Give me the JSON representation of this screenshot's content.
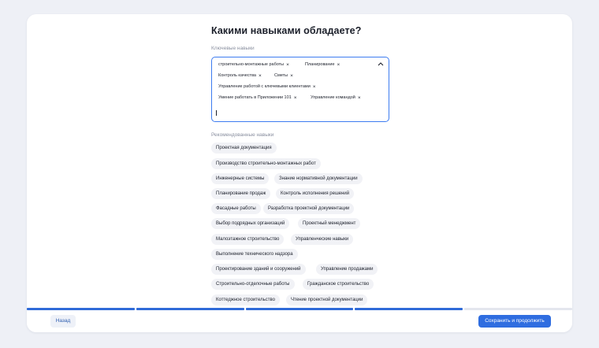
{
  "page": {
    "title": "Какими навыками обладаете?",
    "key_skills_label": "Ключевые навыки",
    "recommended_label": "Рекомендованные навыки"
  },
  "selected_skills": [
    "строительно-монтажные работы",
    "Планирование",
    "Контроль качества",
    "Сметы",
    "Управление работой с ключевыми клиентами",
    "Умение работать в Приложении 101",
    "Управление командой"
  ],
  "remove_glyph": "×",
  "recommended_skills": [
    "Проектная документация",
    "Производство строительно-монтажных работ",
    "Инженерные системы",
    "Знание нормативной документации",
    "Планирование продаж",
    "Контроль исполнения решений",
    "Фасадные работы",
    "Разработка проектной документации",
    "Выбор подрядных организаций",
    "Проектный менеджмент",
    "Малоэтажное строительство",
    "Управленческие навыки",
    "Выполнение технического надзора",
    "Проектирование зданий и сооружений",
    "Управление продажами",
    "Строительно-отделочные работы",
    "Гражданское строительство",
    "Коттеджное строительство",
    "Чтение проектной документации"
  ],
  "footer": {
    "back_label": "Назад",
    "save_label": "Сохранить и продолжить"
  },
  "progress": {
    "completed_steps": 4,
    "total_steps": 5
  },
  "colors": {
    "accent": "#2f6de0",
    "focus_border": "#3d7cf0",
    "chip_bg": "#f1f2f6",
    "page_bg": "#eef0f6"
  },
  "icons": {
    "collapse": "chevron-up-icon",
    "remove": "close-icon"
  }
}
